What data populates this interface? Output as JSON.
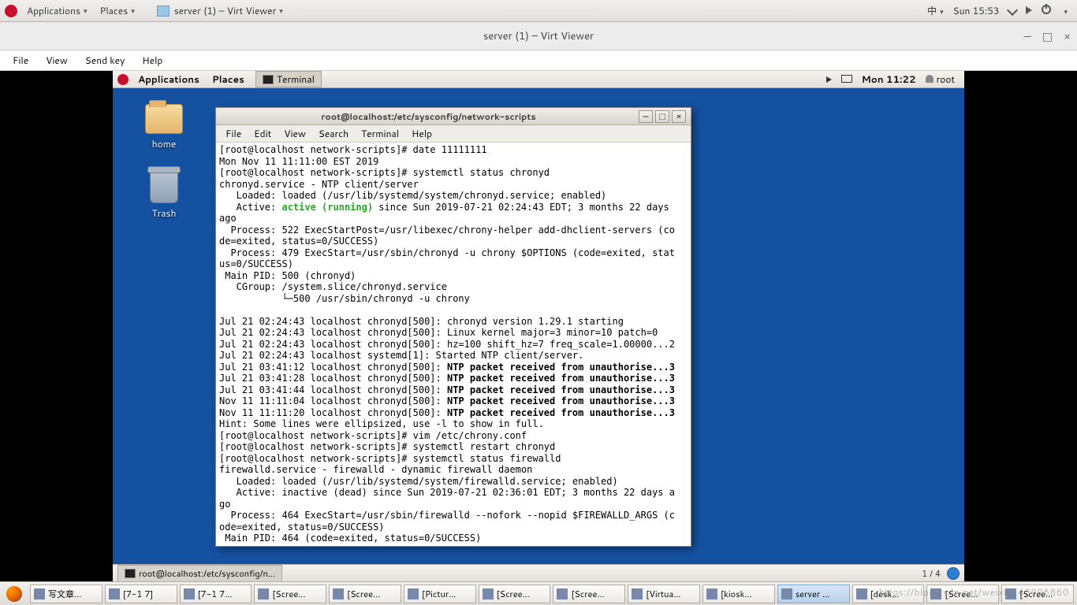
{
  "host_panel": {
    "applications": "Applications",
    "places": "Places",
    "running_app": "server (1) – Virt Viewer",
    "ime": "中",
    "clock": "Sun 15:53"
  },
  "vv": {
    "title": "server (1) – Virt Viewer",
    "menu": {
      "file": "File",
      "view": "View",
      "sendkey": "Send key",
      "help": "Help"
    },
    "controls": {
      "min": "—",
      "max": "□",
      "close": "×"
    }
  },
  "guest": {
    "panel_top": {
      "applications": "Applications",
      "places": "Places",
      "terminal": "Terminal",
      "clock": "Mon 11:22",
      "user": "root"
    },
    "panel_bot": {
      "task": "root@localhost:/etc/sysconfig/n...",
      "workspace": "1 / 4"
    },
    "icons": {
      "home": "home",
      "trash": "Trash"
    },
    "term": {
      "title": "root@localhost:/etc/sysconfig/network-scripts",
      "menu": {
        "file": "File",
        "edit": "Edit",
        "view": "View",
        "search": "Search",
        "terminal": "Terminal",
        "help": "Help"
      },
      "lines": {
        "l1": "[root@localhost network-scripts]# date 11111111",
        "l2": "Mon Nov 11 11:11:00 EST 2019",
        "l3": "[root@localhost network-scripts]# systemctl status chronyd",
        "l4": "chronyd.service - NTP client/server",
        "l5": "   Loaded: loaded (/usr/lib/systemd/system/chronyd.service; enabled)",
        "l6a": "   Active: ",
        "l6b": "active (running)",
        "l6c": " since Sun 2019-07-21 02:24:43 EDT; 3 months 22 days ",
        "l7": "ago",
        "l8": "  Process: 522 ExecStartPost=/usr/libexec/chrony-helper add-dhclient-servers (co",
        "l9": "de=exited, status=0/SUCCESS)",
        "l10": "  Process: 479 ExecStart=/usr/sbin/chronyd -u chrony $OPTIONS (code=exited, stat",
        "l11": "us=0/SUCCESS)",
        "l12": " Main PID: 500 (chronyd)",
        "l13": "   CGroup: /system.slice/chronyd.service",
        "l14": "           └─500 /usr/sbin/chronyd -u chrony",
        "l15": "",
        "l16": "Jul 21 02:24:43 localhost chronyd[500]: chronyd version 1.29.1 starting",
        "l17": "Jul 21 02:24:43 localhost chronyd[500]: Linux kernel major=3 minor=10 patch=0",
        "l18": "Jul 21 02:24:43 localhost chronyd[500]: hz=100 shift_hz=7 freq_scale=1.00000...2",
        "l19": "Jul 21 02:24:43 localhost systemd[1]: Started NTP client/server.",
        "l20a": "Jul 21 03:41:12 localhost chronyd[500]: ",
        "l20b": "NTP packet received from unauthorise...3",
        "l21a": "Jul 21 03:41:28 localhost chronyd[500]: ",
        "l21b": "NTP packet received from unauthorise...3",
        "l22a": "Jul 21 03:41:44 localhost chronyd[500]: ",
        "l22b": "NTP packet received from unauthorise...3",
        "l23a": "Nov 11 11:11:04 localhost chronyd[500]: ",
        "l23b": "NTP packet received from unauthorise...3",
        "l24a": "Nov 11 11:11:20 localhost chronyd[500]: ",
        "l24b": "NTP packet received from unauthorise...3",
        "l25": "Hint: Some lines were ellipsized, use -l to show in full.",
        "l26": "[root@localhost network-scripts]# vim /etc/chrony.conf",
        "l27": "[root@localhost network-scripts]# systemctl restart chronyd",
        "l28": "[root@localhost network-scripts]# systemctl status firewalld",
        "l29": "firewalld.service - firewalld - dynamic firewall daemon",
        "l30": "   Loaded: loaded (/usr/lib/systemd/system/firewalld.service; enabled)",
        "l31": "   Active: inactive (dead) since Sun 2019-07-21 02:36:01 EDT; 3 months 22 days a",
        "l32": "go",
        "l33": "  Process: 464 ExecStart=/usr/sbin/firewalld --nofork --nopid $FIREWALLD_ARGS (c",
        "l34": "ode=exited, status=0/SUCCESS)",
        "l35": " Main PID: 464 (code=exited, status=0/SUCCESS)"
      }
    }
  },
  "taskbar": {
    "items": [
      "写文章...",
      "[7-1 7]",
      "[7-1 7...",
      "[Scree...",
      "[Scree...",
      "[Pictur...",
      "[Scree...",
      "[Scree...",
      "[Virtua...",
      "[kiosk...",
      "server ...",
      "[desk...",
      "[Scree...",
      "[Scree..."
    ],
    "active_index": 10
  },
  "watermark": "https://blog.csdn.net/weixin_42996860"
}
